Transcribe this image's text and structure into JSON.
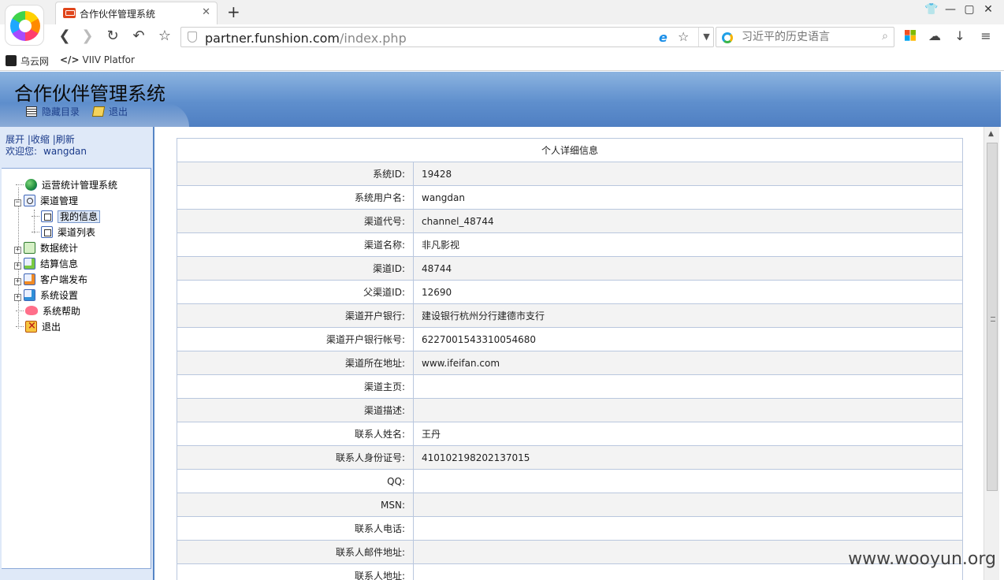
{
  "browser": {
    "tab_title": "合作伙伴管理系统",
    "url_host": "partner.funshion.com",
    "url_path": "/index.php",
    "search_placeholder": "习近平的历史语言",
    "bookmarks": [
      "乌云网",
      "VIIV Platfor"
    ],
    "bookmark_code_icon": "</>"
  },
  "header": {
    "title": "合作伙伴管理系统",
    "hide_menu": "隐藏目录",
    "logout": "退出"
  },
  "sidebar": {
    "expand": "展开",
    "collapse": "收缩",
    "refresh": "刷新",
    "welcome": "欢迎您:",
    "username": "wangdan",
    "tree": [
      {
        "label": "运营统计管理系统",
        "icon": "globe-icon"
      },
      {
        "label": "渠道管理",
        "icon": "folder-icon",
        "expanded": true
      },
      {
        "label": "我的信息",
        "icon": "doc-icon",
        "selected": true
      },
      {
        "label": "渠道列表",
        "icon": "doc-icon"
      },
      {
        "label": "数据统计",
        "icon": "sheet-icon"
      },
      {
        "label": "结算信息",
        "icon": "calc-icon"
      },
      {
        "label": "客户端发布",
        "icon": "publish-icon"
      },
      {
        "label": "系统设置",
        "icon": "settings-icon"
      },
      {
        "label": "系统帮助",
        "icon": "heart-icon"
      },
      {
        "label": "退出",
        "icon": "exit-icon"
      }
    ]
  },
  "detail": {
    "title": "个人详细信息",
    "rows": [
      {
        "label": "系统ID:",
        "value": "19428"
      },
      {
        "label": "系统用户名:",
        "value": "wangdan"
      },
      {
        "label": "渠道代号:",
        "value": "channel_48744"
      },
      {
        "label": "渠道名称:",
        "value": "非凡影视"
      },
      {
        "label": "渠道ID:",
        "value": "48744"
      },
      {
        "label": "父渠道ID:",
        "value": "12690"
      },
      {
        "label": "渠道开户银行:",
        "value": "建设银行杭州分行建德市支行"
      },
      {
        "label": "渠道开户银行帐号:",
        "value": "6227001543310054680"
      },
      {
        "label": "渠道所在地址:",
        "value": "www.ifeifan.com"
      },
      {
        "label": "渠道主页:",
        "value": ""
      },
      {
        "label": "渠道描述:",
        "value": ""
      },
      {
        "label": "联系人姓名:",
        "value": "王丹"
      },
      {
        "label": "联系人身份证号:",
        "value": "410102198202137015"
      },
      {
        "label": "QQ:",
        "value": ""
      },
      {
        "label": "MSN:",
        "value": ""
      },
      {
        "label": "联系人电话:",
        "value": ""
      },
      {
        "label": "联系人邮件地址:",
        "value": ""
      },
      {
        "label": "联系人地址:",
        "value": ""
      }
    ]
  },
  "watermark": "www.wooyun.org"
}
